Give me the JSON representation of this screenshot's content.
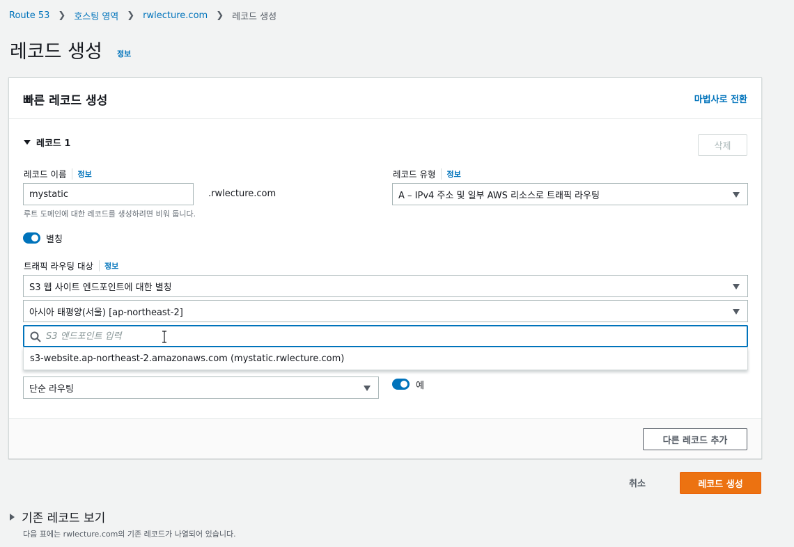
{
  "breadcrumb": {
    "items": [
      "Route 53",
      "호스팅 영역",
      "rwlecture.com"
    ],
    "current": "레코드 생성"
  },
  "page": {
    "title": "레코드 생성",
    "info": "정보"
  },
  "card": {
    "title": "빠른 레코드 생성",
    "wizard_link": "마법사로 전환",
    "record_section": "레코드 1",
    "delete_label": "삭제",
    "record_name": {
      "label": "레코드 이름",
      "info": "정보",
      "value": "mystatic",
      "suffix": ".rwlecture.com",
      "hint": "루트 도메인에 대한 레코드를 생성하려면 비워 둡니다."
    },
    "record_type": {
      "label": "레코드 유형",
      "info": "정보",
      "value": "A – IPv4 주소 및 일부 AWS 리소스로 트래픽 라우팅"
    },
    "alias": {
      "label": "별칭",
      "enabled": true
    },
    "routing_target": {
      "label": "트래픽 라우팅 대상",
      "info": "정보",
      "endpoint_type": "S3 웹 사이트 엔드포인트에 대한 별칭",
      "region": "아시아 태평양(서울) [ap-northeast-2]",
      "search_placeholder": "S3 엔드포인트 입력",
      "option": "s3-website.ap-northeast-2.amazonaws.com (mystatic.rwlecture.com)"
    },
    "routing_policy": {
      "value": "단순 라우팅"
    },
    "evaluate_health": {
      "label": "예",
      "enabled": true
    },
    "add_record_label": "다른 레코드 추가"
  },
  "actions": {
    "cancel": "취소",
    "create": "레코드 생성"
  },
  "existing": {
    "title": "기존 레코드 보기",
    "description": "다음 표에는 rwlecture.com의 기존 레코드가 나열되어 있습니다."
  },
  "colors": {
    "link": "#0073bb",
    "primary_button": "#ec7211",
    "toggle_on": "#0073bb"
  }
}
